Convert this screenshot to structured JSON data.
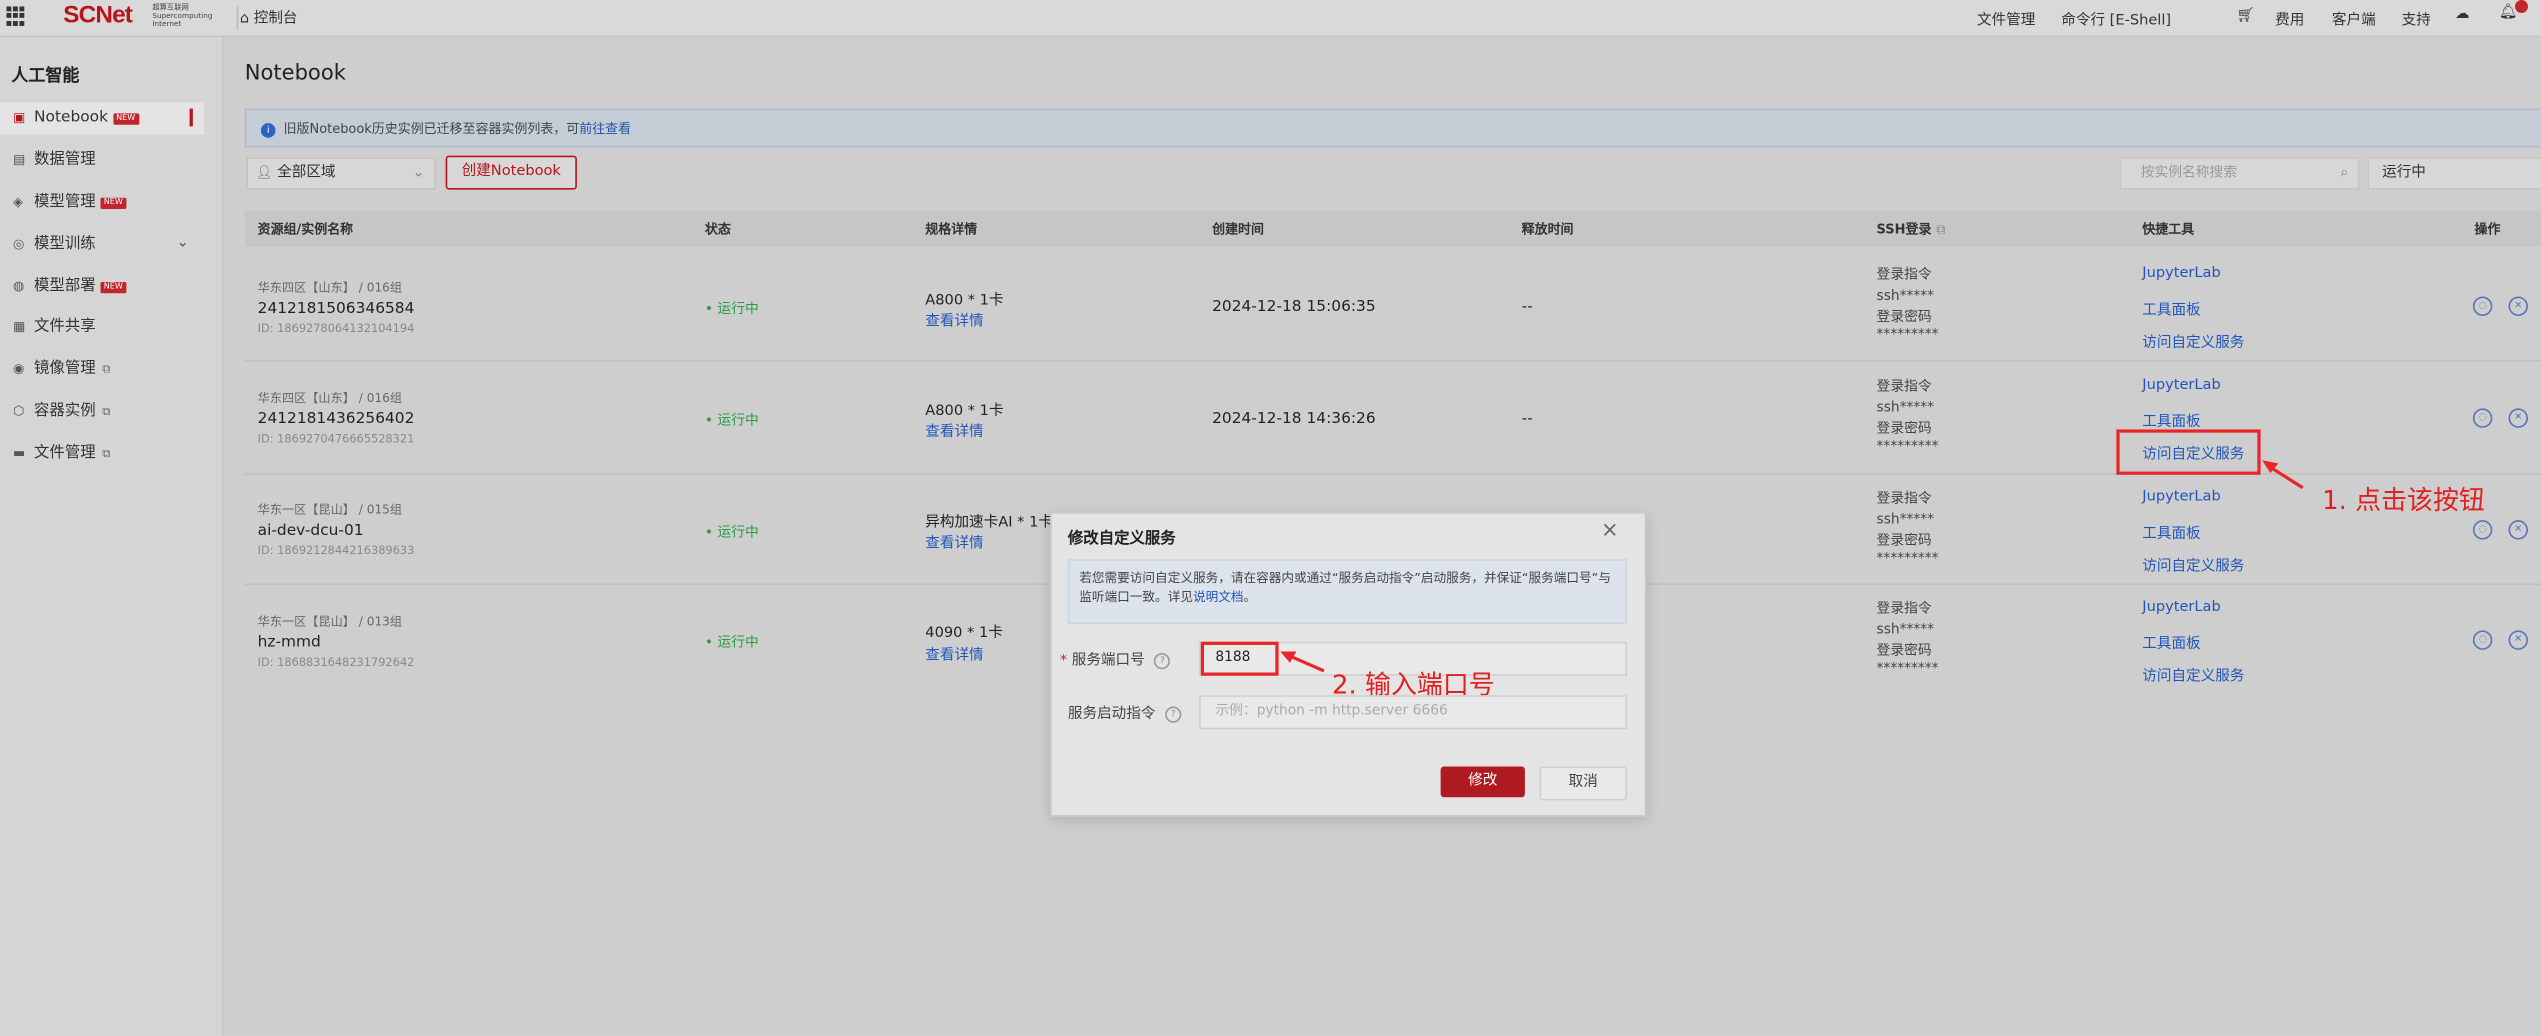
{
  "topbar": {
    "logo": "SCNet",
    "logo_sub": "超算互联网 Supercomputing Internet",
    "home_icon": "home-icon",
    "console": "控制台",
    "nav": [
      "文件管理",
      "命令行 [E-Shell]",
      "费用",
      "客户端",
      "支持"
    ],
    "cart_icon": "cart-icon",
    "cloud_icon": "cloud-download-icon",
    "bell_icon": "bell-icon"
  },
  "sidebar": {
    "title": "人工智能",
    "items": [
      {
        "label": "Notebook",
        "badge": "NEW",
        "icon": "notebook-icon"
      },
      {
        "label": "数据管理",
        "icon": "database-icon"
      },
      {
        "label": "模型管理",
        "badge": "NEW",
        "icon": "model-icon"
      },
      {
        "label": "模型训练",
        "icon": "training-icon"
      },
      {
        "label": "模型部署",
        "badge": "NEW",
        "icon": "deploy-icon"
      },
      {
        "label": "文件共享",
        "icon": "file-share-icon"
      },
      {
        "label": "镜像管理",
        "icon": "image-icon"
      },
      {
        "label": "容器实例",
        "icon": "container-icon"
      },
      {
        "label": "文件管理",
        "icon": "folder-icon"
      }
    ]
  },
  "main": {
    "title": "Notebook",
    "info": "旧版Notebook历史实例已迁移至容器实例列表，可",
    "info_link": "前往查看",
    "region": "全部区域",
    "create_button": "创建Notebook",
    "search_placeholder": "按实例名称搜索",
    "status_filter": "运行中",
    "columns": [
      "资源组/实例名称",
      "状态",
      "规格详情",
      "创建时间",
      "释放时间",
      "SSH登录",
      "快捷工具",
      "操作"
    ],
    "rows": [
      {
        "group": "华东四区【山东】 / 016组",
        "name": "2412181506346584",
        "id": "ID: 1869278064132104194",
        "status": "运行中",
        "spec": "A800 * 1卡",
        "detail": "查看详情",
        "created": "2024-12-18 15:06:35",
        "released": "--"
      },
      {
        "group": "华东四区【山东】 / 016组",
        "name": "2412181436256402",
        "id": "ID: 1869270476665528321",
        "status": "运行中",
        "spec": "A800 * 1卡",
        "detail": "查看详情",
        "created": "2024-12-18 14:36:26",
        "released": "--"
      },
      {
        "group": "华东一区【昆山】 / 015组",
        "name": "ai-dev-dcu-01",
        "id": "ID: 1869212844216389633",
        "status": "运行中",
        "spec": "异构加速卡AI * 1卡",
        "detail": "查看详情",
        "created": "",
        "released": ""
      },
      {
        "group": "华东一区【昆山】 / 013组",
        "name": "hz-mmd",
        "id": "ID: 1868831648231792642",
        "status": "运行中",
        "spec": "4090 * 1卡",
        "detail": "查看详情",
        "created": "",
        "released": ""
      }
    ],
    "ssh": {
      "cmd_label": "登录指令",
      "cmd_value": "ssh*****",
      "pwd_label": "登录密码",
      "pwd_value": "*********"
    },
    "tools": [
      "JupyterLab",
      "工具面板",
      "访问自定义服务"
    ]
  },
  "modal": {
    "title": "修改自定义服务",
    "note": "若您需要访问自定义服务，请在容器内或通过“服务启动指令”启动服务，并保证“服务端口号”与监听端口一致。详见",
    "note_link": "说明文档",
    "port_label": "服务端口号",
    "port_value": "8188",
    "cmd_label": "服务启动指令",
    "cmd_placeholder": "示例：python -m http.server 6666",
    "ok": "修改",
    "cancel": "取消"
  },
  "annotations": {
    "step1": "1. 点击该按钮",
    "step2": "2. 输入端口号",
    "color": "#e8262a"
  }
}
